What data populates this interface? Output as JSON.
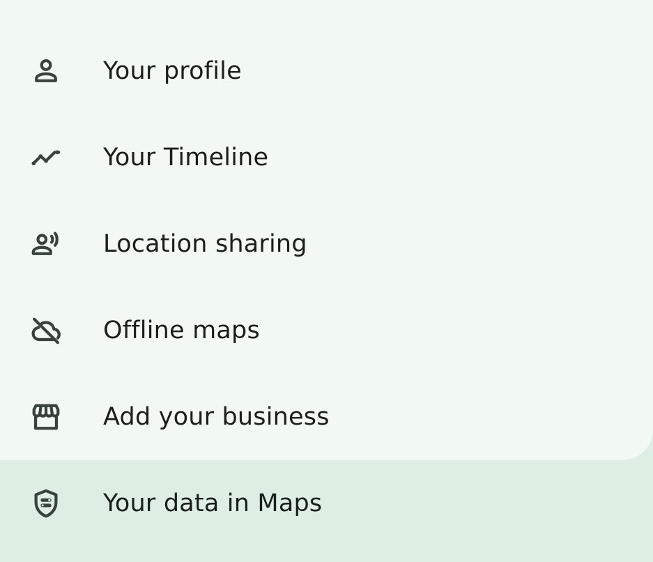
{
  "menu": {
    "items": [
      {
        "label": "Your profile",
        "icon": "person-icon"
      },
      {
        "label": "Your Timeline",
        "icon": "timeline-icon"
      },
      {
        "label": "Location sharing",
        "icon": "location-sharing-icon"
      },
      {
        "label": "Offline maps",
        "icon": "offline-cloud-icon"
      },
      {
        "label": "Add your business",
        "icon": "storefront-icon"
      },
      {
        "label": "Your data in Maps",
        "icon": "shield-icon"
      }
    ]
  },
  "colors": {
    "card_background": "#f2f9f3",
    "page_background": "#dfeee3",
    "icon_color": "#3a423d",
    "text_color": "#1b1f1c"
  }
}
